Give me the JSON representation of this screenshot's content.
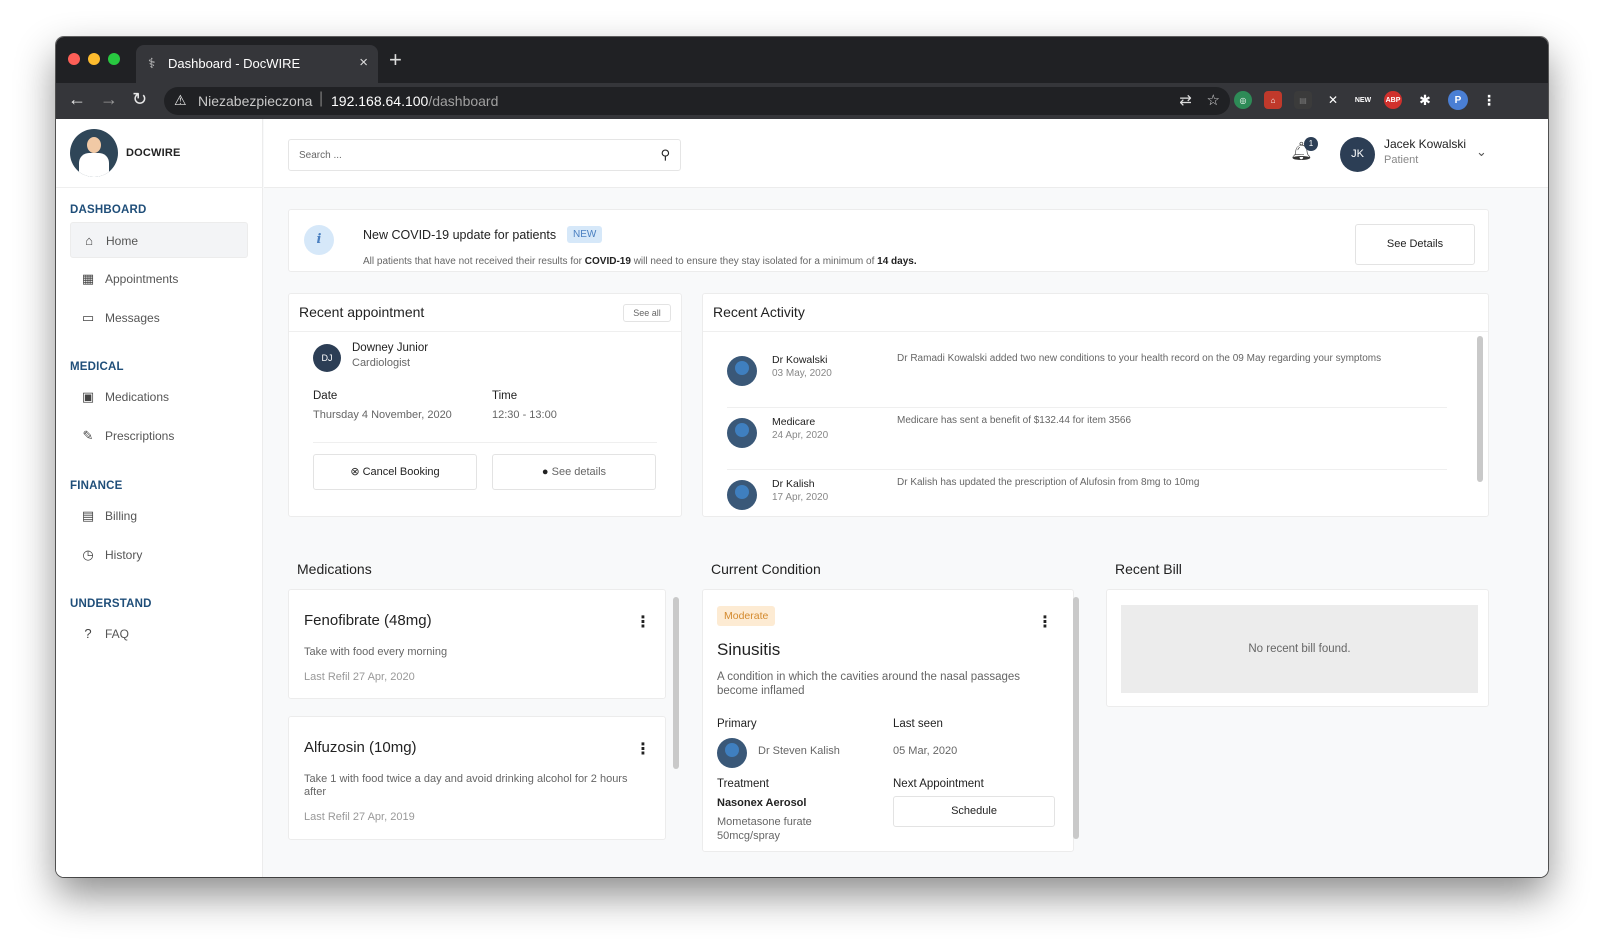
{
  "browser": {
    "tab_title": "Dashboard - DocWIRE",
    "tab_close": "×",
    "new_tab": "+",
    "insecure_label": "Niezabezpieczona",
    "url_host": "192.168.64.100",
    "url_path": "/dashboard",
    "ext_new": "NEW",
    "ext_abp": "ABP",
    "profile_initial": "P"
  },
  "brand": {
    "name": "DOCWIRE"
  },
  "sidebar": {
    "sections": [
      {
        "title": "DASHBOARD",
        "items": [
          {
            "label": "Home"
          },
          {
            "label": "Appointments"
          },
          {
            "label": "Messages"
          }
        ]
      },
      {
        "title": "MEDICAL",
        "items": [
          {
            "label": "Medications"
          },
          {
            "label": "Prescriptions"
          }
        ]
      },
      {
        "title": "FINANCE",
        "items": [
          {
            "label": "Billing"
          },
          {
            "label": "History"
          }
        ]
      },
      {
        "title": "UNDERSTAND",
        "items": [
          {
            "label": "FAQ"
          }
        ]
      }
    ]
  },
  "header": {
    "search_placeholder": "Search ...",
    "notifications_count": "1",
    "user_initials": "JK",
    "user_name": "Jacek Kowalski",
    "user_role": "Patient"
  },
  "alert": {
    "title": "New COVID-19 update for patients",
    "badge": "NEW",
    "msg_part1": "All patients that have not received their results for ",
    "msg_bold1": "COVID-19",
    "msg_part2": " will need to ensure they stay isolated for a minimum of ",
    "msg_bold2": "14 days.",
    "button": "See Details"
  },
  "recent_appointment": {
    "title": "Recent appointment",
    "see_all": "See all",
    "doctor_initials": "DJ",
    "doctor_name": "Downey Junior",
    "doctor_specialty": "Cardiologist",
    "date_label": "Date",
    "date_value": "Thursday 4 November, 2020",
    "time_label": "Time",
    "time_value": "12:30 - 13:00",
    "cancel_label": "Cancel Booking",
    "details_label": "See details"
  },
  "recent_activity": {
    "title": "Recent Activity",
    "items": [
      {
        "name": "Dr Kowalski",
        "date": "03 May, 2020",
        "message": "Dr Ramadi Kowalski added two new conditions to your health record on the 09 May regarding your symptoms"
      },
      {
        "name": "Medicare",
        "date": "24 Apr, 2020",
        "message": "Medicare has sent a benefit of $132.44 for item 3566"
      },
      {
        "name": "Dr Kalish",
        "date": "17 Apr, 2020",
        "message": "Dr Kalish has updated the prescription of Alufosin from 8mg to 10mg"
      }
    ]
  },
  "medications": {
    "title": "Medications",
    "items": [
      {
        "name": "Fenofibrate (48mg)",
        "instructions": "Take with food every morning",
        "refill": "Last Refil 27 Apr, 2020"
      },
      {
        "name": "Alfuzosin (10mg)",
        "instructions": "Take 1 with food twice a day and avoid drinking alcohol for 2 hours after",
        "refill": "Last Refil 27 Apr, 2019"
      }
    ]
  },
  "current_condition": {
    "title": "Current Condition",
    "severity": "Moderate",
    "name": "Sinusitis",
    "description": "A condition in which the cavities around the nasal passages become inflamed",
    "primary_label": "Primary",
    "primary_doctor": "Dr Steven Kalish",
    "last_seen_label": "Last seen",
    "last_seen_value": "05 Mar, 2020",
    "treatment_label": "Treatment",
    "treatment_name": "Nasonex Aerosol",
    "treatment_detail": "Mometasone furate 50mcg/spray",
    "next_appt_label": "Next Appointment",
    "schedule_label": "Schedule"
  },
  "recent_bill": {
    "title": "Recent Bill",
    "empty_message": "No recent bill found."
  },
  "colors": {
    "accent_navy": "#2c3e55",
    "section_blue": "#1f4e79",
    "badge_blue_bg": "#d6e8f9",
    "moderate_bg": "#fdebd3",
    "moderate_text": "#d48a2e"
  }
}
